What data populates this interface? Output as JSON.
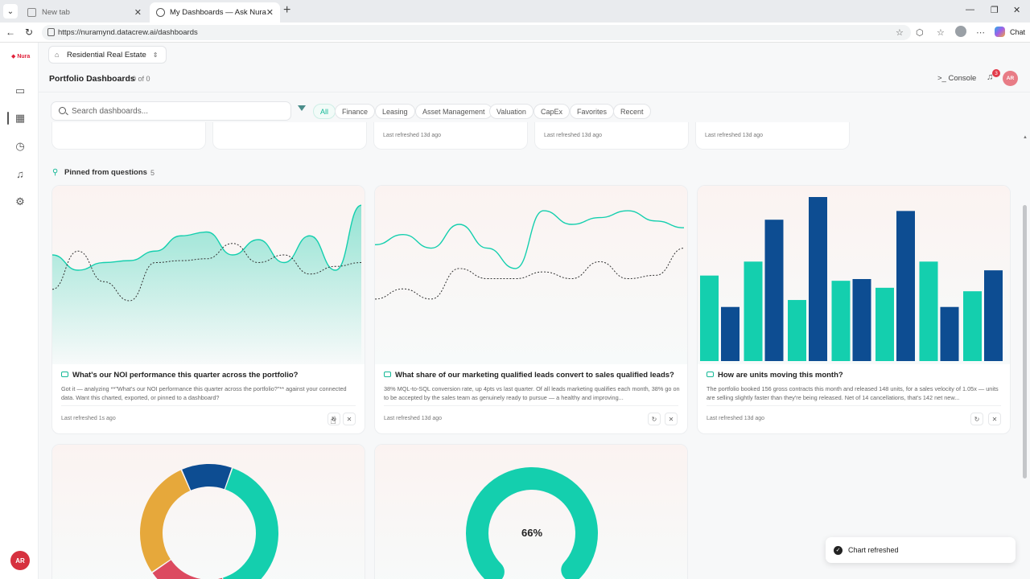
{
  "browser": {
    "tabs": [
      {
        "title": "New tab"
      },
      {
        "title": "My Dashboards — Ask Nura"
      }
    ],
    "url": "https://nuramynd.datacrew.ai/dashboards",
    "chat_label": "Chat"
  },
  "workspace": {
    "name": "Residential Real Estate"
  },
  "header": {
    "title": "Portfolio Dashboards",
    "count": "0 of 0",
    "console_label": "Console",
    "notifications": "3",
    "user_initials": "AR"
  },
  "search": {
    "placeholder": "Search dashboards..."
  },
  "filters": [
    "All",
    "Finance",
    "Leasing",
    "Asset Management",
    "Valuation",
    "CapEx",
    "Favorites",
    "Recent"
  ],
  "top_cards": [
    {
      "refreshed": ""
    },
    {
      "refreshed": ""
    },
    {
      "refreshed": "Last refreshed 13d ago"
    },
    {
      "refreshed": "Last refreshed 13d ago"
    },
    {
      "refreshed": "Last refreshed 13d ago"
    }
  ],
  "pinned": {
    "title": "Pinned from questions",
    "count": "5"
  },
  "cards": [
    {
      "question": "What's our NOI performance this quarter across the portfolio?",
      "answer": "Got it — analyzing **\"What's our NOI performance this quarter across the portfolio?\"** against your connected data. Want this charted, exported, or pinned to a dashboard?",
      "refreshed": "Last refreshed 1s ago"
    },
    {
      "question": "What share of our marketing qualified leads convert to sales qualified leads?",
      "answer": "38% MQL-to-SQL conversion rate, up 4pts vs last quarter. Of all leads marketing qualifies each month, 38% go on to be accepted by the sales team as genuinely ready to pursue — a healthy and improving...",
      "refreshed": "Last refreshed 13d ago"
    },
    {
      "question": "How are units moving this month?",
      "answer": "The portfolio booked 156 gross contracts this month and released 148 units, for a sales velocity of 1.05x — units are selling slightly faster than they're being released. Net of 14 cancellations, that's 142 net new...",
      "refreshed": "Last refreshed 13d ago"
    }
  ],
  "gauge": {
    "value": 0.66,
    "label": "66%"
  },
  "toast": {
    "message": "Chart refreshed"
  },
  "colors": {
    "teal": "#14cfae",
    "navy": "#0d4d92",
    "orange": "#e6a83b",
    "red": "#dc4a60",
    "accent": "#12b896"
  },
  "chart_data": [
    {
      "type": "area",
      "note": "NOI trend mini-chart (no axes shown)",
      "series": [
        {
          "values": [
            48,
            40,
            44,
            45,
            50,
            58,
            60,
            48,
            56,
            44,
            58,
            40,
            74
          ]
        },
        {
          "values": [
            30,
            50,
            34,
            24,
            44,
            45,
            46,
            54,
            44,
            48,
            38,
            42,
            44
          ]
        }
      ]
    },
    {
      "type": "line",
      "note": "MQL to SQL mini-chart (no axes shown)",
      "series": [
        {
          "values": [
            60,
            66,
            58,
            72,
            58,
            46,
            80,
            72,
            76,
            80,
            74,
            70
          ]
        },
        {
          "values": [
            28,
            34,
            28,
            46,
            40,
            40,
            44,
            40,
            50,
            40,
            42,
            58
          ]
        }
      ]
    },
    {
      "type": "bar",
      "note": "Units moving mini-chart (no axes shown)",
      "series": [
        {
          "values": [
            49,
            57,
            35,
            46,
            42,
            57,
            40
          ]
        },
        {
          "values": [
            31,
            81,
            94,
            47,
            86,
            31,
            52
          ]
        }
      ]
    },
    {
      "type": "pie",
      "note": "donut (cut off)",
      "values": [
        40,
        20,
        28,
        12
      ]
    }
  ]
}
